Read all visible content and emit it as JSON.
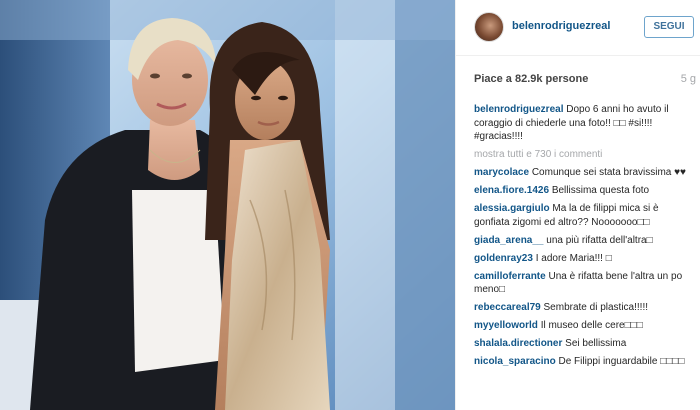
{
  "photo": {
    "description_icon": "photo-of-two-women"
  },
  "header": {
    "username": "belenrodriguezreal",
    "follow_label": "SEGUI"
  },
  "stats": {
    "likes": "Piace a 82.9k persone",
    "age": "5 g"
  },
  "caption": {
    "user": "belenrodriguezreal",
    "text": "Dopo 6 anni ho avuto il coraggio di chiederle una foto!! □□ #si!!!! #gracias!!!!"
  },
  "more_comments": "mostra tutti e 730 i commenti",
  "comments": [
    {
      "user": "marycolace",
      "text": "Comunque sei stata bravissima ♥♥"
    },
    {
      "user": "elena.fiore.1426",
      "text": "Bellissima questa foto"
    },
    {
      "user": "alessia.gargiulo",
      "text": "Ma la de filippi mica si è gonfiata zigomi ed altro?? Nooooooo□□"
    },
    {
      "user": "giada_arena__",
      "text": "una più rifatta dell'altra□"
    },
    {
      "user": "goldenray23",
      "text": "I adore Maria!!! □"
    },
    {
      "user": "camilloferrante",
      "text": "Una è rifatta bene l'altra un po meno□"
    },
    {
      "user": "rebeccareal79",
      "text": "Sembrate di plastica!!!!!"
    },
    {
      "user": "myyelloworld",
      "text": "Il museo delle cere□□□"
    },
    {
      "user": "shalala.directioner",
      "text": "Sei bellissima"
    },
    {
      "user": "nicola_sparacino",
      "text": "De Filippi inguardabile □□□□"
    }
  ],
  "colors": {
    "link": "#125688",
    "follow_border": "#6ea4cc",
    "muted": "#a5a7aa"
  }
}
